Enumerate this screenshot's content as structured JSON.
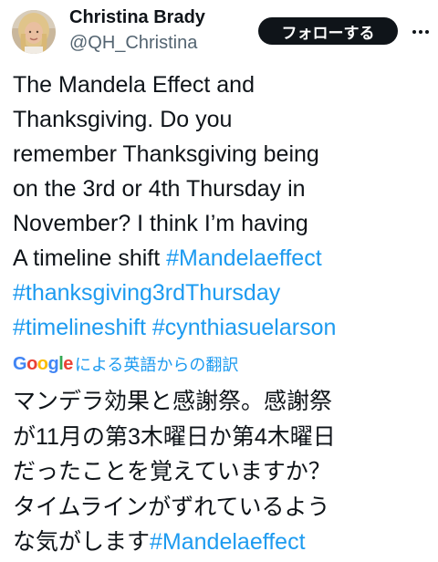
{
  "author": {
    "name": "Christina Brady",
    "handle": "@QH_Christina"
  },
  "follow_button": "フォローする",
  "tweet": {
    "line1": "The Mandela Effect and",
    "line2": "Thanksgiving.  Do you",
    "line3": "remember Thanksgiving being",
    "line4": "on the 3rd or 4th Thursday in",
    "line5": "November?    I think I’m having",
    "line6_text": "A timeline shift ",
    "hashtags": [
      "#Mandelaeffect",
      "#thanksgiving3rdThursday",
      "#timelineshift",
      "#cynthiasuelarson"
    ]
  },
  "translation": {
    "google_brand": [
      "G",
      "o",
      "o",
      "g",
      "l",
      "e"
    ],
    "brand_colors": [
      "#4285F4",
      "#EA4335",
      "#FBBC05",
      "#4285F4",
      "#34A853",
      "#EA4335"
    ],
    "label": "による英語からの翻訳",
    "line1": "マンデラ効果と感謝祭。感謝祭",
    "line2": "が11月の第3木曜日か第4木曜日",
    "line3": "だったことを覚えていますか？",
    "line4": "タイムラインがずれているよう",
    "line5_text": "な気がします",
    "line5_tag": "#Mandelaeffect"
  },
  "colors": {
    "link": "#1d9bf0",
    "text": "#0f1419",
    "secondary": "#536471"
  },
  "icons": [
    "avatar-photo",
    "more-options-icon"
  ]
}
